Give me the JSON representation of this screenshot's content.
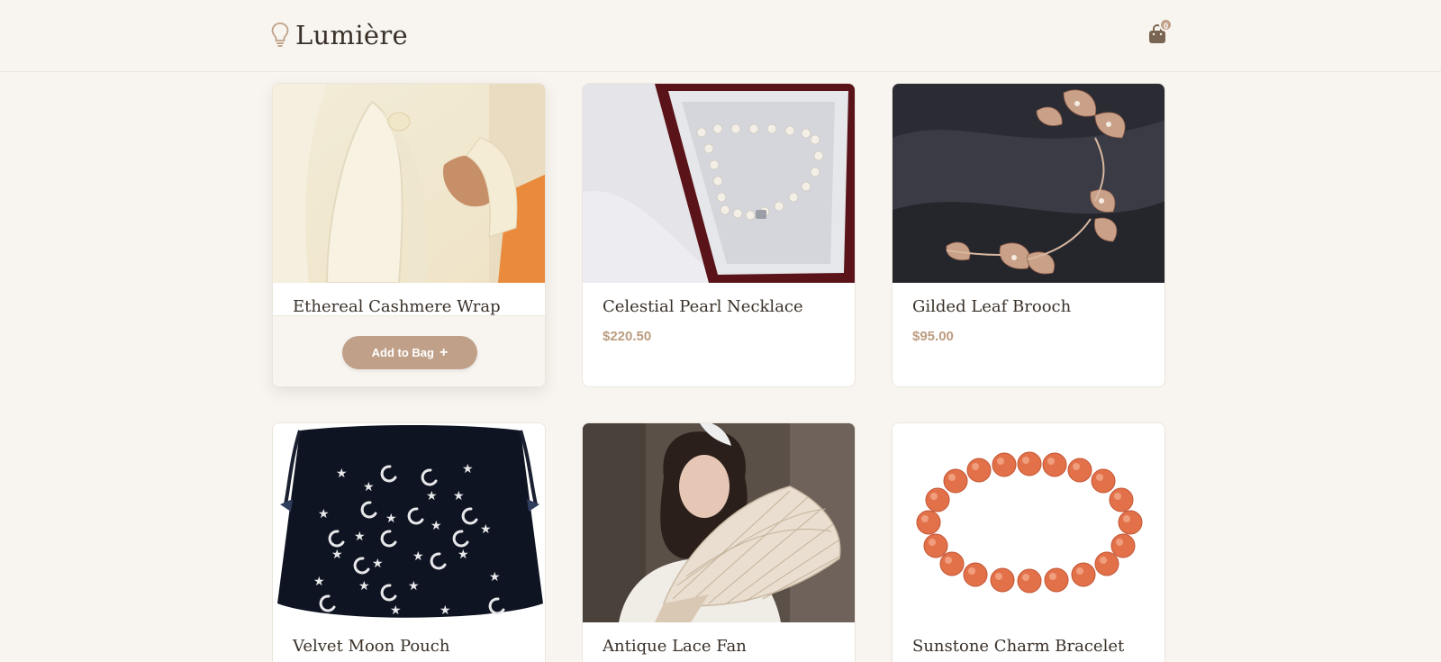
{
  "brand": {
    "name": "Lumière",
    "icon": "lightbulb-icon"
  },
  "cart": {
    "count": "0",
    "icon": "shopping-bag-icon"
  },
  "products": [
    {
      "name": "Ethereal Cashmere Wrap",
      "price": "",
      "action": "Add to Bag"
    },
    {
      "name": "Celestial Pearl Necklace",
      "price": "$220.50"
    },
    {
      "name": "Gilded Leaf Brooch",
      "price": "$95.00"
    },
    {
      "name": "Velvet Moon Pouch",
      "price": ""
    },
    {
      "name": "Antique Lace Fan",
      "price": ""
    },
    {
      "name": "Sunstone Charm Bracelet",
      "price": ""
    }
  ],
  "colors": {
    "accent": "#c0a088",
    "background": "#f8f5f0",
    "text": "#3a3129"
  }
}
